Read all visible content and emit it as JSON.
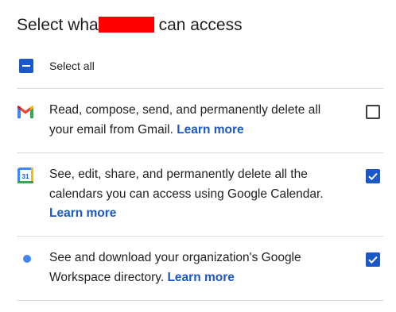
{
  "dialog": {
    "title_before": "Select what",
    "title_after": "can access"
  },
  "select_all": {
    "label": "Select all",
    "state": "indeterminate"
  },
  "permissions": [
    {
      "icon": "gmail-icon",
      "text": "Read, compose, send, and permanently delete all your email from Gmail.",
      "link": "Learn more",
      "checked": false
    },
    {
      "icon": "google-calendar-icon",
      "icon_label": "31",
      "text": "See, edit, share, and permanently delete all the calendars you can access using Google Calendar.",
      "link": "Learn more",
      "checked": true
    },
    {
      "icon": "blue-dot-icon",
      "text": "See and download your organization's Google Workspace directory.",
      "link": "Learn more",
      "checked": true
    }
  ],
  "colors": {
    "accent": "#1a57c7",
    "text": "#202124",
    "divider": "#dadce0",
    "redaction": "#ff0000",
    "dot": "#4285f4"
  }
}
